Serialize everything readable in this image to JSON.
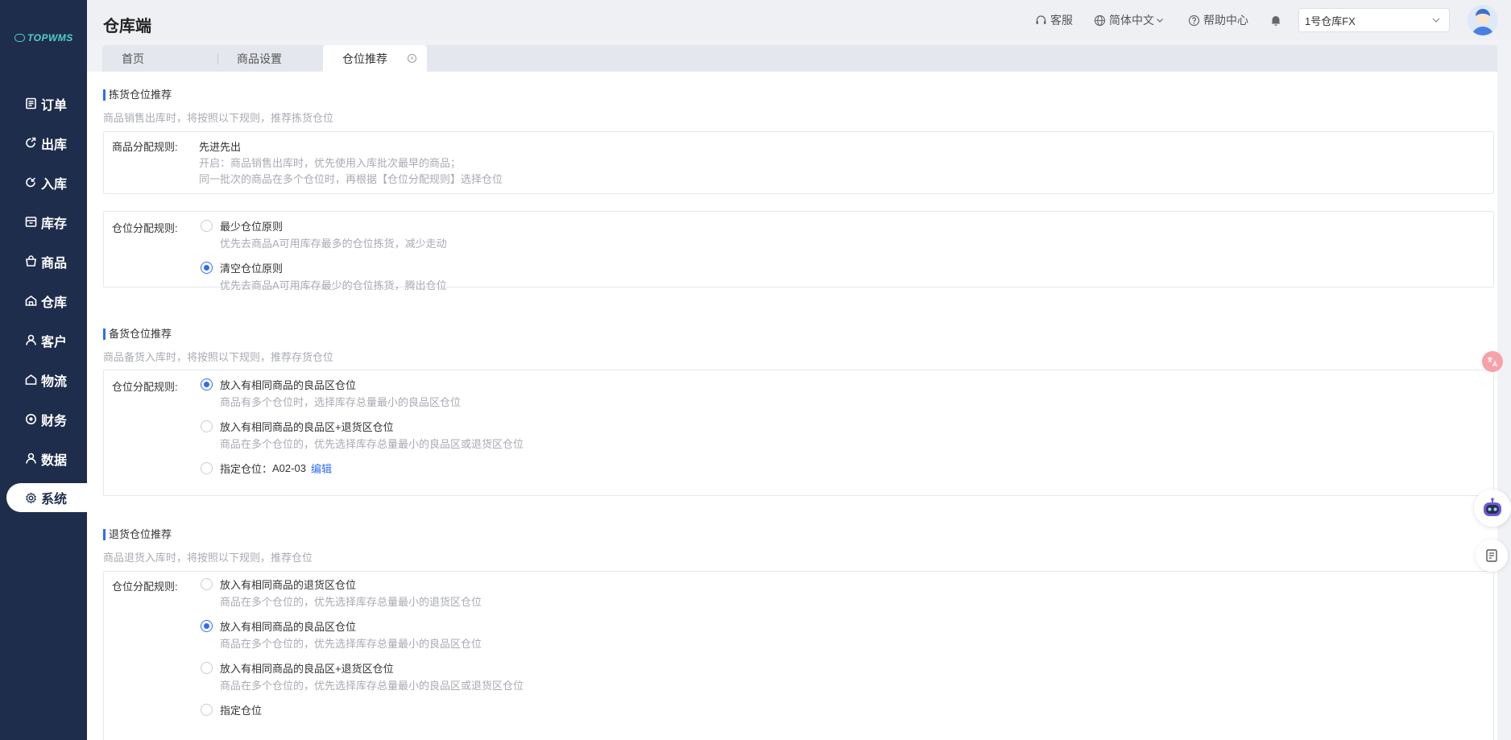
{
  "app": {
    "logo_text": "TOPWMS",
    "title": "仓库端"
  },
  "sidebar": {
    "items": [
      {
        "label": "订单",
        "icon": "order-icon"
      },
      {
        "label": "出库",
        "icon": "outbound-icon"
      },
      {
        "label": "入库",
        "icon": "inbound-icon"
      },
      {
        "label": "库存",
        "icon": "inventory-icon"
      },
      {
        "label": "商品",
        "icon": "bag-icon"
      },
      {
        "label": "仓库",
        "icon": "warehouse-icon"
      },
      {
        "label": "客户",
        "icon": "user-icon"
      },
      {
        "label": "物流",
        "icon": "logistics-icon"
      },
      {
        "label": "财务",
        "icon": "finance-icon"
      },
      {
        "label": "数据",
        "icon": "data-icon"
      },
      {
        "label": "系统",
        "icon": "gear-icon",
        "active": true
      }
    ]
  },
  "header": {
    "service": "客服",
    "language": "简体中文",
    "help": "帮助中心",
    "warehouse_selected": "1号仓库FX"
  },
  "tabs": [
    {
      "label": "首页"
    },
    {
      "label": "商品设置"
    },
    {
      "label": "仓位推荐",
      "active": true,
      "closable": true
    }
  ],
  "picking": {
    "title": "拣货仓位推荐",
    "subtitle": "商品销售出库时，将按照以下规则，推荐拣货仓位",
    "alloc_label": "商品分配规则:",
    "alloc_value": "先进先出",
    "alloc_desc1": "开启：商品销售出库时，优先使用入库批次最早的商品；",
    "alloc_desc2": "同一批次的商品在多个仓位时，再根据【仓位分配规则】选择仓位",
    "loc_label": "仓位分配规则:",
    "options": [
      {
        "label": "最少仓位原则",
        "desc": "优先去商品A可用库存最多的仓位拣货，减少走动",
        "checked": false
      },
      {
        "label": "清空仓位原则",
        "desc": "优先去商品A可用库存最少的仓位拣货，腾出仓位",
        "checked": true
      }
    ]
  },
  "stocking": {
    "title": "备货仓位推荐",
    "subtitle": "商品备货入库时，将按照以下规则，推荐存货仓位",
    "loc_label": "仓位分配规则:",
    "options": [
      {
        "label": "放入有相同商品的良品区仓位",
        "desc": "商品有多个仓位时，选择库存总量最小的良品区仓位",
        "checked": true
      },
      {
        "label": "放入有相同商品的良品区+退货区仓位",
        "desc": "商品在多个仓位的，优先选择库存总量最小的良品区或退货区仓位",
        "checked": false
      }
    ],
    "designated_label": "指定仓位：",
    "designated_value": "A02-03",
    "edit_label": "编辑"
  },
  "returns": {
    "title": "退货仓位推荐",
    "subtitle": "商品退货入库时，将按照以下规则，推荐仓位",
    "loc_label": "仓位分配规则:",
    "options": [
      {
        "label": "放入有相同商品的退货区仓位",
        "desc": "商品在多个仓位的，优先选择库存总量最小的退货区仓位",
        "checked": false
      },
      {
        "label": "放入有相同商品的良品区仓位",
        "desc": "商品在多个仓位的，优先选择库存总量最小的良品区仓位",
        "checked": true
      },
      {
        "label": "放入有相同商品的良品区+退货区仓位",
        "desc": "商品在多个仓位的，优先选择库存总量最小的良品区或退货区仓位",
        "checked": false
      }
    ],
    "designated_label": "指定仓位"
  },
  "colors": {
    "sidebar_bg": "#1f2d4d",
    "accent": "#2f6cf6",
    "muted_text": "#a8abb2"
  }
}
